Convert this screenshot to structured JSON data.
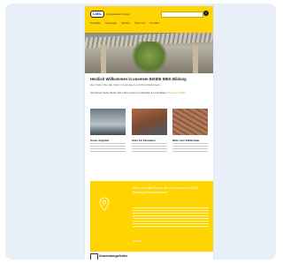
{
  "header": {
    "logo_text": "LIXIL",
    "brand_line": "Competence Center",
    "search_placeholder": "",
    "nav": [
      "Produkte",
      "Lösungen",
      "Service",
      "Über uns",
      "Kontakt"
    ]
  },
  "intro": {
    "headline": "Herzlich Willkommen in unserem INSIDE BIEK Bildung",
    "subline": "Hier finden Sie alle Infos zu Lösungen und Dienstleistungen",
    "paragraph": "Auf dieser Seite finden Sie Infos rund um Gebäude & Immobilien",
    "paragraph_link": "Themen & Mehr"
  },
  "tiles": [
    {
      "title": "Unser Angebot"
    },
    {
      "title": "Alles für Fassaden"
    },
    {
      "title": "Mehr zum Klinkerbau"
    }
  ],
  "promo": {
    "title": "Mehr Kontakte finden Sie bei unserem INSIDE-Bildung Ansprechpartner",
    "link": "Kontakt"
  },
  "footer": {
    "title": "Anwendungsfelder"
  },
  "colors": {
    "brand_yellow": "#ffd400",
    "card_background": "#e9eff8"
  }
}
